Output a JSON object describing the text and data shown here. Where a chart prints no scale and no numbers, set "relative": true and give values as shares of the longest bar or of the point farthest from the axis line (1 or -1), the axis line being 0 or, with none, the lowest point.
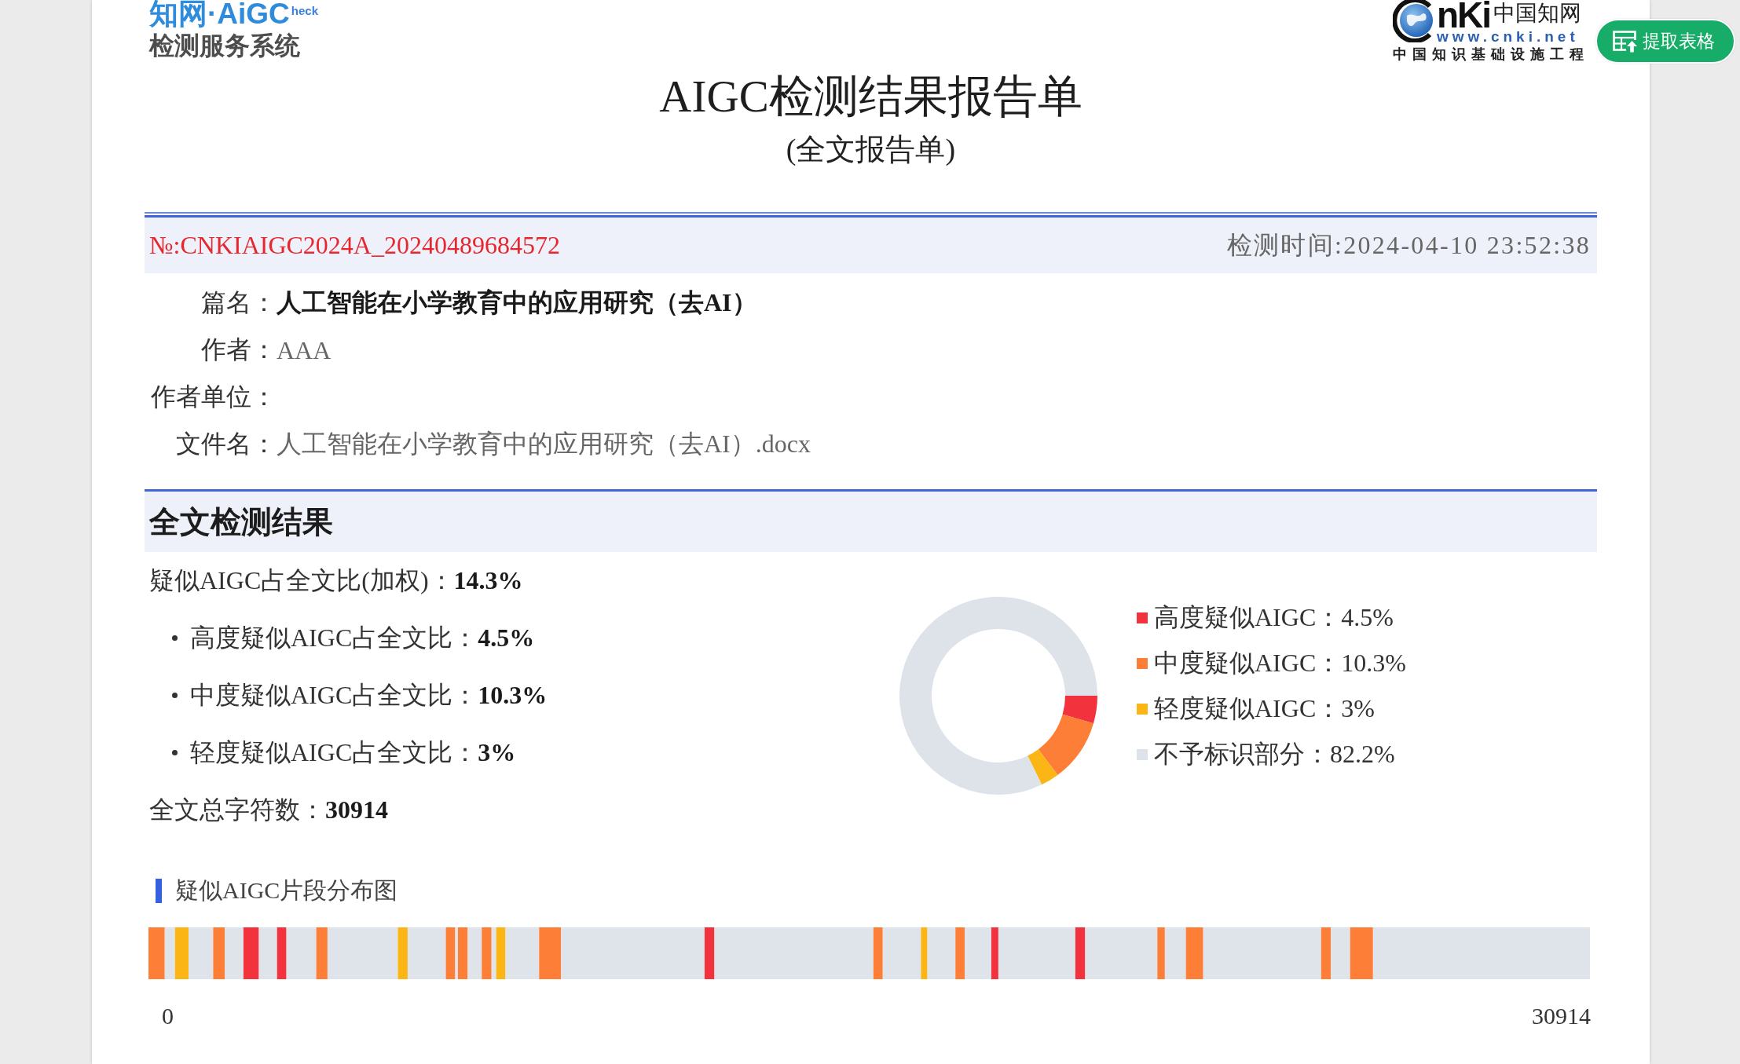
{
  "logo": {
    "brand": "知网·AiGC",
    "brand_suffix": "heck",
    "subtitle": "检测服务系统"
  },
  "publisher_logo": {
    "wordmark": "nKi",
    "chinese_name": "中国知网",
    "url": "www.cnki.net",
    "tagline": "中国知识基础设施工程"
  },
  "extract_button": {
    "label": "提取表格"
  },
  "report": {
    "title": "AIGC检测结果报告单",
    "subtitle": "(全文报告单)",
    "number": "№:CNKIAIGC2024A_20240489684572",
    "check_time": "检测时间:2024-04-10 23:52:38",
    "info": [
      {
        "label": "篇名：",
        "value": "人工智能在小学教育中的应用研究（去AI）",
        "kind": "title"
      },
      {
        "label": "作者：",
        "value": "AAA",
        "kind": "plain"
      },
      {
        "label": "作者单位：",
        "kind": "plain"
      },
      {
        "label": "文件名：",
        "value": "人工智能在小学教育中的应用研究（去AI）.docx",
        "kind": "plain"
      }
    ]
  },
  "results": {
    "heading": "全文检测结果",
    "stats": [
      {
        "kind": "main",
        "text": "疑似AIGC占全文比(加权)：**14.3%**"
      },
      {
        "kind": "sub",
        "text": "高度疑似AIGC占全文比：**4.5%**"
      },
      {
        "kind": "sub",
        "text": "中度疑似AIGC占全文比：**10.3%**"
      },
      {
        "kind": "sub",
        "text": "轻度疑似AIGC占全文比：**3%**"
      },
      {
        "kind": "main",
        "text": "全文总字符数：**30914**"
      }
    ],
    "legend": [
      {
        "text": "高度疑似AIGC：4.5%",
        "color": "#f2333d"
      },
      {
        "text": "中度疑似AIGC：10.3%",
        "color": "#fd7f37"
      },
      {
        "text": "轻度疑似AIGC：3%",
        "color": "#fbb514"
      },
      {
        "text": "不予标识部分：82.2%",
        "color": "#dee2e9"
      }
    ],
    "chart_data": {
      "type": "donut",
      "values": [
        4.5,
        10.3,
        3,
        82.2
      ]
    }
  },
  "distribution": {
    "heading": "疑似AIGC片段分布图",
    "scale_labels": [
      "0",
      "30914"
    ],
    "chart_data": {
      "type": "bar",
      "orientation": "horizontal",
      "stacked": true,
      "relative": true,
      "categories": [
        null
      ],
      "series": [
        {
          "color": "#fd7f37",
          "values": [
            0.0113
          ]
        },
        {
          "color": "#dfe3ea",
          "values": [
            0.0071
          ]
        },
        {
          "color": "#fbb514",
          "values": [
            0.0094
          ]
        },
        {
          "color": "#dfe3ea",
          "values": [
            0.0171
          ]
        },
        {
          "color": "#fd7f37",
          "values": [
            0.0081
          ]
        },
        {
          "color": "#dfe3ea",
          "values": [
            0.0129
          ]
        },
        {
          "color": "#f2333d",
          "values": [
            0.0107
          ]
        },
        {
          "color": "#dfe3ea",
          "values": [
            0.0126
          ]
        },
        {
          "color": "#f2333d",
          "values": [
            0.0065
          ]
        },
        {
          "color": "#dfe3ea",
          "values": [
            0.0207
          ]
        },
        {
          "color": "#fd7f37",
          "values": [
            0.0078
          ]
        },
        {
          "color": "#dfe3ea",
          "values": [
            0.0488
          ]
        },
        {
          "color": "#fbb514",
          "values": [
            0.0068
          ]
        },
        {
          "color": "#dfe3ea",
          "values": [
            0.0265
          ]
        },
        {
          "color": "#fd7f37",
          "values": [
            0.0065
          ]
        },
        {
          "color": "#dfe3ea",
          "values": [
            0.0019
          ]
        },
        {
          "color": "#fd7f37",
          "values": [
            0.0068
          ]
        },
        {
          "color": "#dfe3ea",
          "values": [
            0.0097
          ]
        },
        {
          "color": "#fd7f37",
          "values": [
            0.0068
          ]
        },
        {
          "color": "#dfe3ea",
          "values": [
            0.0032
          ]
        },
        {
          "color": "#fbb514",
          "values": [
            0.0065
          ]
        },
        {
          "color": "#dfe3ea",
          "values": [
            0.0233
          ]
        },
        {
          "color": "#fd7f37",
          "values": [
            0.0152
          ]
        },
        {
          "color": "#dfe3ea",
          "values": [
            0.0996
          ]
        },
        {
          "color": "#f2333d",
          "values": [
            0.0068
          ]
        },
        {
          "color": "#dfe3ea",
          "values": [
            0.1103
          ]
        },
        {
          "color": "#fd7f37",
          "values": [
            0.0065
          ]
        },
        {
          "color": "#dfe3ea",
          "values": [
            0.0265
          ]
        },
        {
          "color": "#fbb514",
          "values": [
            0.0045
          ]
        },
        {
          "color": "#dfe3ea",
          "values": [
            0.0194
          ]
        },
        {
          "color": "#fd7f37",
          "values": [
            0.0065
          ]
        },
        {
          "color": "#dfe3ea",
          "values": [
            0.0184
          ]
        },
        {
          "color": "#f2333d",
          "values": [
            0.0049
          ]
        },
        {
          "color": "#dfe3ea",
          "values": [
            0.0534
          ]
        },
        {
          "color": "#f2333d",
          "values": [
            0.0068
          ]
        },
        {
          "color": "#dfe3ea",
          "values": [
            0.0501
          ]
        },
        {
          "color": "#fd7f37",
          "values": [
            0.0052
          ]
        },
        {
          "color": "#dfe3ea",
          "values": [
            0.0146
          ]
        },
        {
          "color": "#fd7f37",
          "values": [
            0.012
          ]
        },
        {
          "color": "#dfe3ea",
          "values": [
            0.0818
          ]
        },
        {
          "color": "#fd7f37",
          "values": [
            0.0068
          ]
        },
        {
          "color": "#dfe3ea",
          "values": [
            0.0133
          ]
        },
        {
          "color": "#fd7f37",
          "values": [
            0.0159
          ]
        },
        {
          "color": "#dfe3ea",
          "values": [
            0.1505
          ]
        }
      ]
    }
  }
}
